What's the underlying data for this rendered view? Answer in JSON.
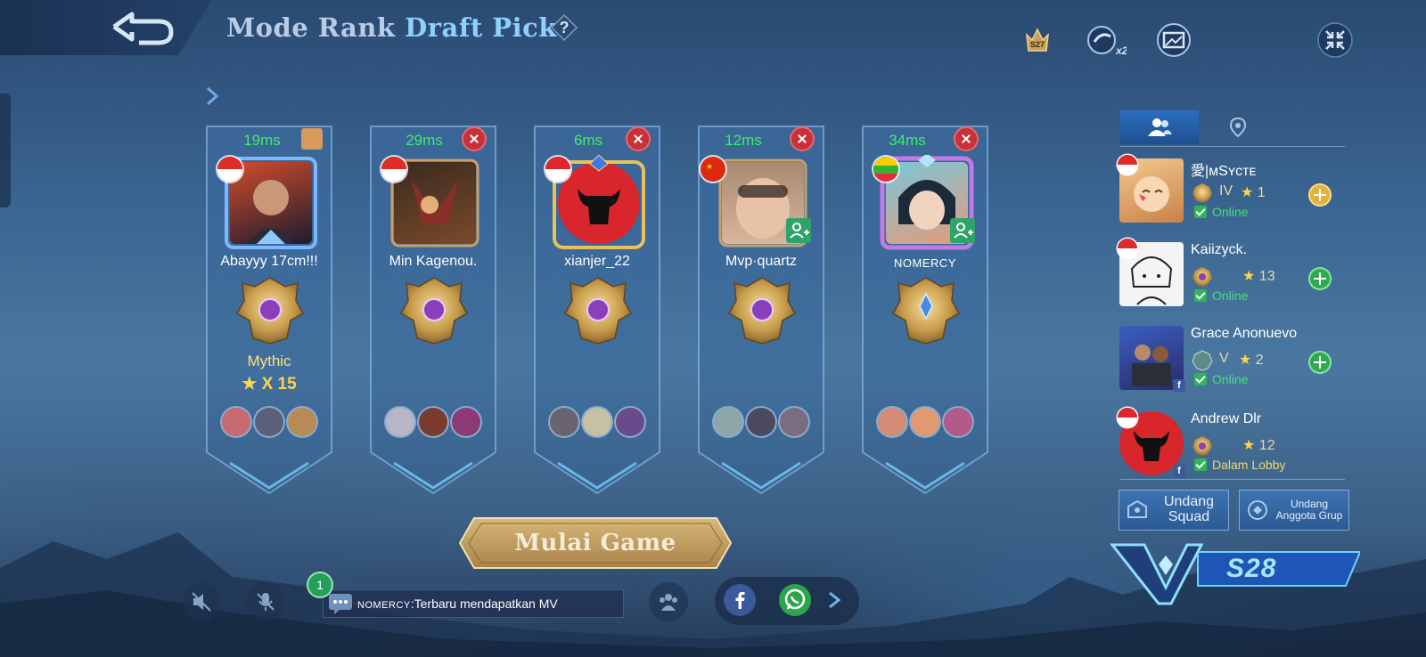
{
  "header": {
    "mode_label": "Mode Rank",
    "mode_name": "Draft Pick",
    "help_label": "?",
    "season_badge": "S27",
    "double_badge": "x2"
  },
  "players": [
    {
      "ping": "19ms",
      "name": "Abayyy 17cm!!!",
      "flag": "ID",
      "rank_title": "Mythic",
      "stars": "X 15",
      "corner": "home",
      "heroes": [
        "#c86a72",
        "#5c5f7a",
        "#b88a56"
      ]
    },
    {
      "ping": "29ms",
      "name": "Min Kagenou.",
      "flag": "ID",
      "corner": "kick",
      "heroes": [
        "#b9b4c6",
        "#7a3c2e",
        "#8b3a76"
      ]
    },
    {
      "ping": "6ms",
      "name": "xianjer_22",
      "flag": "SG",
      "corner": "kick",
      "heroes": [
        "#6a6470",
        "#c7c0a2",
        "#6a4a8a"
      ]
    },
    {
      "ping": "12ms",
      "name": "Mvp·quartz",
      "flag": "CN",
      "corner": "kick",
      "heroes": [
        "#8fa6a8",
        "#4c4a60",
        "#7c6c80"
      ]
    },
    {
      "ping": "34ms",
      "name": "NOMERCY",
      "flag": "MM",
      "corner": "kick",
      "heroes": [
        "#d48c76",
        "#e09a72",
        "#b25a8a"
      ]
    }
  ],
  "start_button": "Mulai Game",
  "chat": {
    "badge": "1",
    "sender": "NOMERCY",
    "message": ":Terbaru mendapatkan MV"
  },
  "friends_panel": {
    "tabs": [
      "friends-icon",
      "location-icon"
    ],
    "friends": [
      {
        "name": "愛|ᴍSʏᴄᴛᴇ",
        "tier": "IV",
        "stars": "1",
        "status": "Online",
        "action": "gold"
      },
      {
        "name": "Kaiizyck.",
        "tier": "",
        "stars": "13",
        "status": "Online",
        "action": "green"
      },
      {
        "name": "Grace Anonuevo",
        "tier": "V",
        "stars": "2",
        "status": "Online",
        "action": "green"
      },
      {
        "name": "Andrew Dlr",
        "tier": "",
        "stars": "12",
        "status": "Dalam Lobby",
        "action": ""
      }
    ],
    "invite_squad": "Undang Squad",
    "invite_group": "Undang Anggota Grup"
  },
  "season_label": "S28",
  "colors": {
    "ping": "#3dee6a",
    "accent_blue": "#8fd0ff",
    "gold": "#ffd34d"
  }
}
